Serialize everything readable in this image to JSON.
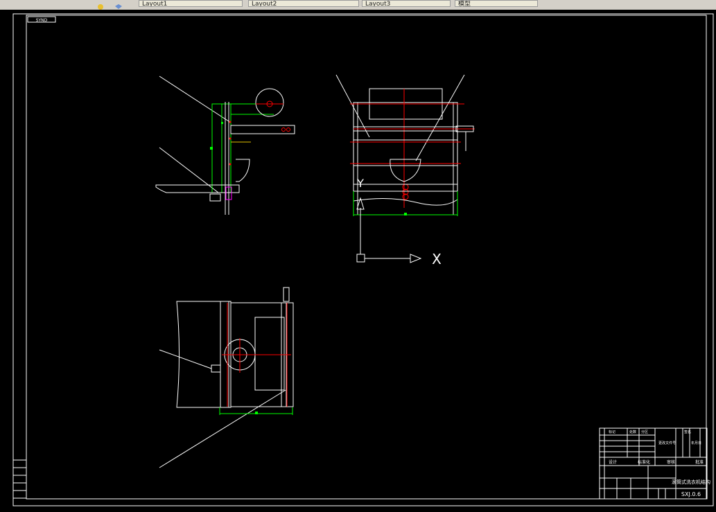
{
  "app": {
    "tabs": [
      {
        "label": "Layout1"
      },
      {
        "label": "Layout2"
      },
      {
        "label": "Layout3"
      },
      {
        "label": "模型"
      }
    ]
  },
  "drawing": {
    "corner_tag": "SYND",
    "axis_x_label": "X",
    "axis_y_label": "Y",
    "title_block": {
      "drawing_title": "滚筒式洗衣机结构",
      "drawing_code": "SXJ.0.6",
      "col_headers": [
        "标记",
        "处数",
        "分区",
        "更改文件号",
        "签名",
        "年月日"
      ],
      "role_labels": [
        "设计",
        "标准化",
        "审核",
        "批准"
      ]
    }
  },
  "colors": {
    "background": "#000000",
    "line_white": "#ffffff",
    "line_green": "#00ff00",
    "line_red": "#ff0000",
    "accent_magenta": "#ff00ff"
  }
}
